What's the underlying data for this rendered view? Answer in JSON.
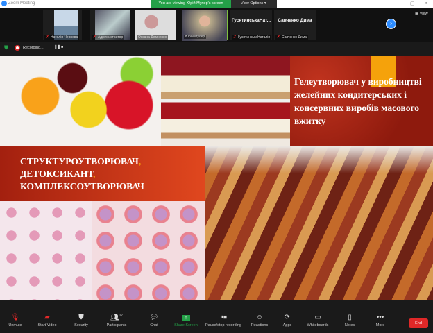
{
  "window": {
    "title": "Zoom Meeting",
    "banner": "You are viewing Юрій Мулер's screen",
    "view_options": "View Options",
    "view": "View"
  },
  "gallery": [
    {
      "name": "Наталія Чернова",
      "muted": true
    },
    {
      "name": "Администратор",
      "muted": true
    },
    {
      "name": "Оксана Демченко",
      "muted": false
    },
    {
      "name": "Юрій Мулер",
      "muted": false
    },
    {
      "name": "ГусятинськаНаталія",
      "display": "ГусятинськаНат...",
      "muted": true
    },
    {
      "name": "Савченко Дима",
      "display": "Савченко Дима",
      "muted": true
    }
  ],
  "recording": {
    "label": "Recording..."
  },
  "slide": {
    "title_right": "Гелеутворювач у виробництві желейних кондитерських і консервних виробів масового вжитку",
    "band_line1": "СТРУКТУРОУТВОРЮВАЧ",
    "band_line2": "ДЕТОКСИКАНТ",
    "band_line3": "КОМПЛЕКСОУТВОРЮВАЧ",
    "comma": ","
  },
  "toolbar": {
    "unmute": "Unmute",
    "start_video": "Start Video",
    "security": "Security",
    "participants": "Participants",
    "participants_count": "17",
    "chat": "Chat",
    "share_screen": "Share Screen",
    "pause_recording": "Pause/stop recording",
    "reactions": "Reactions",
    "apps": "Apps",
    "whiteboards": "Whiteboards",
    "notes": "Notes",
    "more": "More",
    "end": "End"
  },
  "colors": {
    "accent": "#2d8cff",
    "share": "#24a148",
    "end": "#e02828",
    "slide_red": "#a3200f",
    "slide_orange": "#f5a20b"
  }
}
